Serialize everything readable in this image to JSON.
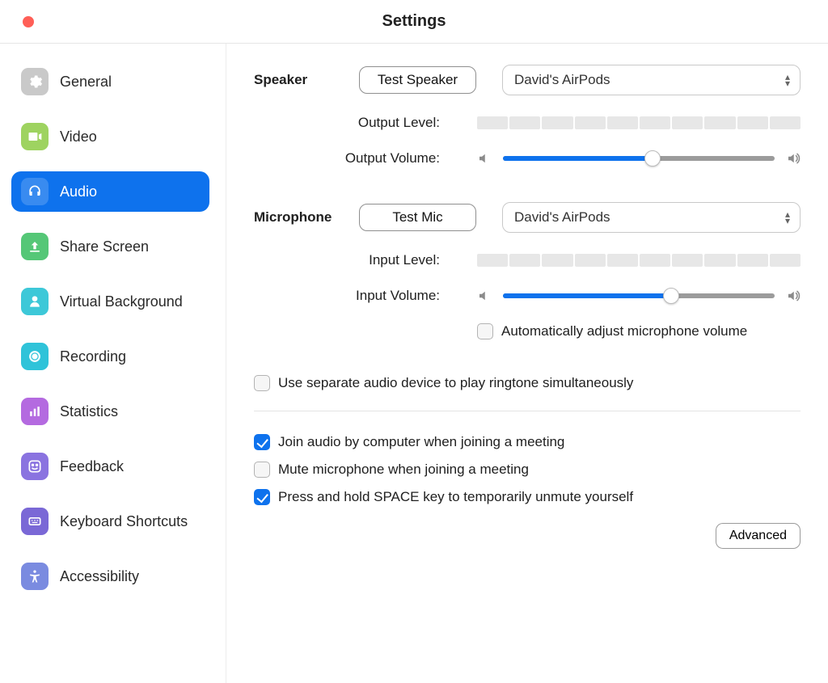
{
  "window": {
    "title": "Settings"
  },
  "sidebar": {
    "items": [
      {
        "label": "General"
      },
      {
        "label": "Video"
      },
      {
        "label": "Audio"
      },
      {
        "label": "Share Screen"
      },
      {
        "label": "Virtual Background"
      },
      {
        "label": "Recording"
      },
      {
        "label": "Statistics"
      },
      {
        "label": "Feedback"
      },
      {
        "label": "Keyboard Shortcuts"
      },
      {
        "label": "Accessibility"
      }
    ],
    "active_index": 2
  },
  "speaker": {
    "heading": "Speaker",
    "test_button": "Test Speaker",
    "device": "David's AirPods",
    "output_level_label": "Output Level:",
    "output_volume_label": "Output Volume:",
    "volume_percent": 55
  },
  "microphone": {
    "heading": "Microphone",
    "test_button": "Test Mic",
    "device": "David's AirPods",
    "input_level_label": "Input Level:",
    "input_volume_label": "Input Volume:",
    "volume_percent": 62,
    "auto_adjust_label": "Automatically adjust microphone volume",
    "auto_adjust_checked": false
  },
  "options": {
    "ringtone_label": "Use separate audio device to play ringtone simultaneously",
    "ringtone_checked": false,
    "join_audio_label": "Join audio by computer when joining a meeting",
    "join_audio_checked": true,
    "mute_on_join_label": "Mute microphone when joining a meeting",
    "mute_on_join_checked": false,
    "space_unmute_label": "Press and hold SPACE key to temporarily unmute yourself",
    "space_unmute_checked": true
  },
  "advanced_button": "Advanced",
  "colors": {
    "accent": "#0e72ed",
    "sidebar_icons": {
      "general": "#c9c9c9",
      "video": "#9ed360",
      "audio_active": "#0e72ed",
      "share": "#55c777",
      "vbg": "#3dc8d8",
      "recording": "#2fc3d9",
      "stats": "#b46ae0",
      "feedback": "#8a73e0",
      "keyboard": "#7a68d6",
      "accessibility": "#7a8be0"
    }
  }
}
